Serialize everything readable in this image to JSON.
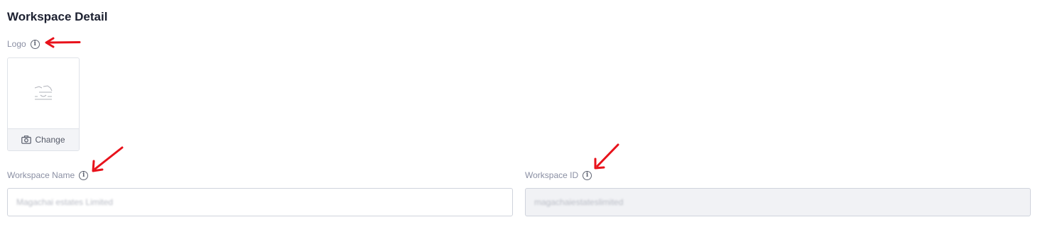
{
  "page": {
    "title": "Workspace Detail"
  },
  "logo": {
    "label": "Logo",
    "change_label": "Change",
    "icons": {
      "info": "info-icon",
      "camera": "camera-icon"
    }
  },
  "workspace_name": {
    "label": "Workspace Name",
    "value": "Magachai estates Limited"
  },
  "workspace_id": {
    "label": "Workspace ID",
    "value": "magachaiestateslimited"
  },
  "colors": {
    "annotation_arrow": "#e8121b",
    "border": "#cfd3dc",
    "label": "#8a8fa3"
  }
}
